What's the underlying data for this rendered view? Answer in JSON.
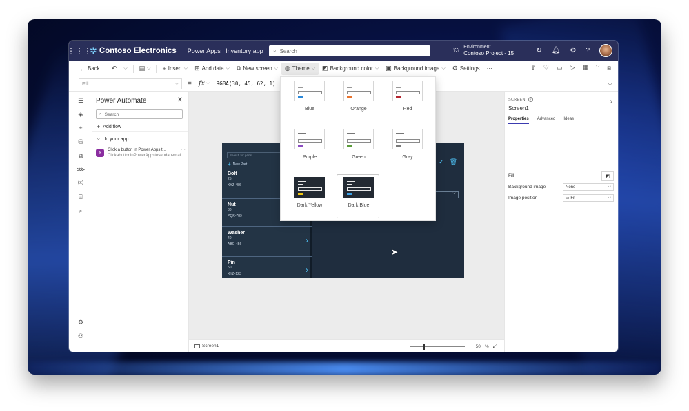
{
  "titlebar": {
    "brand": "Contoso Electronics",
    "breadcrumb": "Power Apps  |  Inventory app",
    "search_placeholder": "Search",
    "environment_label": "Environment",
    "environment_name": "Contoso Project - 15"
  },
  "commandbar": {
    "back": "Back",
    "insert": "Insert",
    "add_data": "Add data",
    "new_screen": "New screen",
    "theme": "Theme",
    "background_color": "Background color",
    "background_image": "Background image",
    "settings": "Settings",
    "more": "···"
  },
  "formula": {
    "property": "Fill",
    "equals": "=",
    "fx": "fx",
    "value": "RGBA(30, 45, 62, 1)"
  },
  "pane": {
    "title": "Power Automate",
    "search_placeholder": "Search",
    "add_flow": "Add flow",
    "section": "In your app",
    "flow_title": "Click a button in Power Apps t...",
    "flow_subtitle": "ClickabuttoninPowerAppstosendanemai..."
  },
  "themes": [
    {
      "label": "Blue",
      "color": "#2b88d8",
      "dark": false
    },
    {
      "label": "Orange",
      "color": "#e8732e",
      "dark": false
    },
    {
      "label": "Red",
      "color": "#b4252f",
      "dark": false
    },
    {
      "label": "Purple",
      "color": "#8c4cc1",
      "dark": false
    },
    {
      "label": "Green",
      "color": "#5c9c3b",
      "dark": false
    },
    {
      "label": "Gray",
      "color": "#7a7a7a",
      "dark": false
    },
    {
      "label": "Dark Yellow",
      "color": "#f2c811",
      "dark": true
    },
    {
      "label": "Dark Blue",
      "color": "#3ba0e6",
      "dark": true
    }
  ],
  "gallery": {
    "search_placeholder": "Search for parts",
    "new_part": "New Part",
    "items": [
      {
        "name": "Bolt",
        "qty": "25",
        "code": "XYZ-456"
      },
      {
        "name": "Nut",
        "qty": "30",
        "code": "PQR-789"
      },
      {
        "name": "Washer",
        "qty": "40",
        "code": "ABC-456"
      },
      {
        "name": "Pin",
        "qty": "50",
        "code": "XYZ-123"
      }
    ]
  },
  "properties": {
    "kicker": "SCREEN",
    "name": "Screen1",
    "tabs": [
      "Properties",
      "Advanced",
      "Ideas"
    ],
    "fill_label": "Fill",
    "bg_image_label": "Background image",
    "bg_image_value": "None",
    "image_position_label": "Image position",
    "image_position_value": "Fit"
  },
  "status": {
    "screen": "Screen1",
    "zoom_minus": "−",
    "zoom_plus": "+",
    "zoom_value": "50",
    "zoom_unit": "%"
  }
}
